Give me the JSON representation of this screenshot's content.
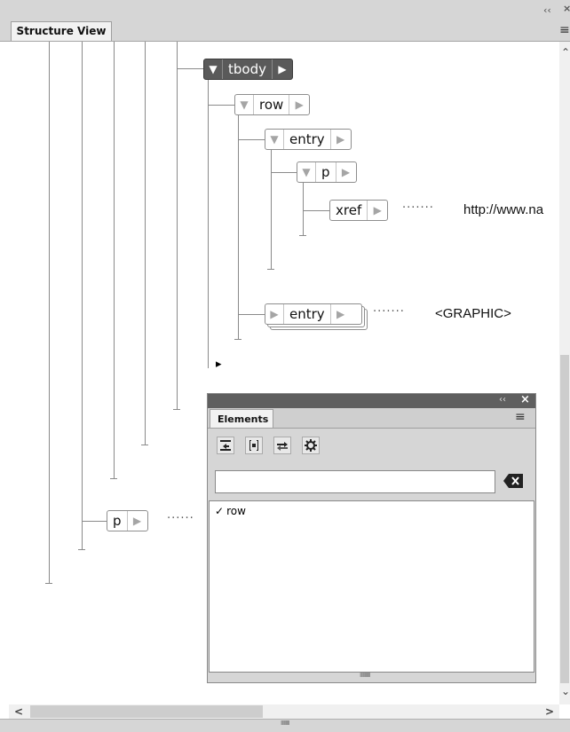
{
  "window": {
    "tab_label": "Structure View",
    "collapse_glyph": "‹‹",
    "close_glyph": "×",
    "menu_glyph": "≡"
  },
  "tree": {
    "nodes": {
      "tbody": "tbody",
      "row": "row",
      "entry1": "entry",
      "p_inner": "p",
      "xref": "xref",
      "entry2": "entry",
      "p_outer": "p"
    },
    "content": {
      "xref_text": "http://www.na",
      "graphic_text": "<GRAPHIC>"
    },
    "dots": "·······",
    "dots_short": "······",
    "expanded_glyph": "▼",
    "collapsed_glyph": "▶",
    "insertion_glyph": "▸"
  },
  "scroll": {
    "up": "⌃",
    "down": "⌄",
    "left": "<",
    "right": ">",
    "grip": "IIIIIIIII"
  },
  "elements_panel": {
    "tab_label": "Elements",
    "collapse_glyph": "‹‹",
    "close_glyph": "×",
    "menu_glyph": "≡",
    "search_value": "",
    "list": [
      {
        "check": "✓",
        "label": "row"
      }
    ],
    "grip": "IIIIIIIIIII",
    "toolbar_icons": [
      "insert-icon",
      "wrap-icon",
      "change-icon",
      "settings-icon"
    ]
  }
}
